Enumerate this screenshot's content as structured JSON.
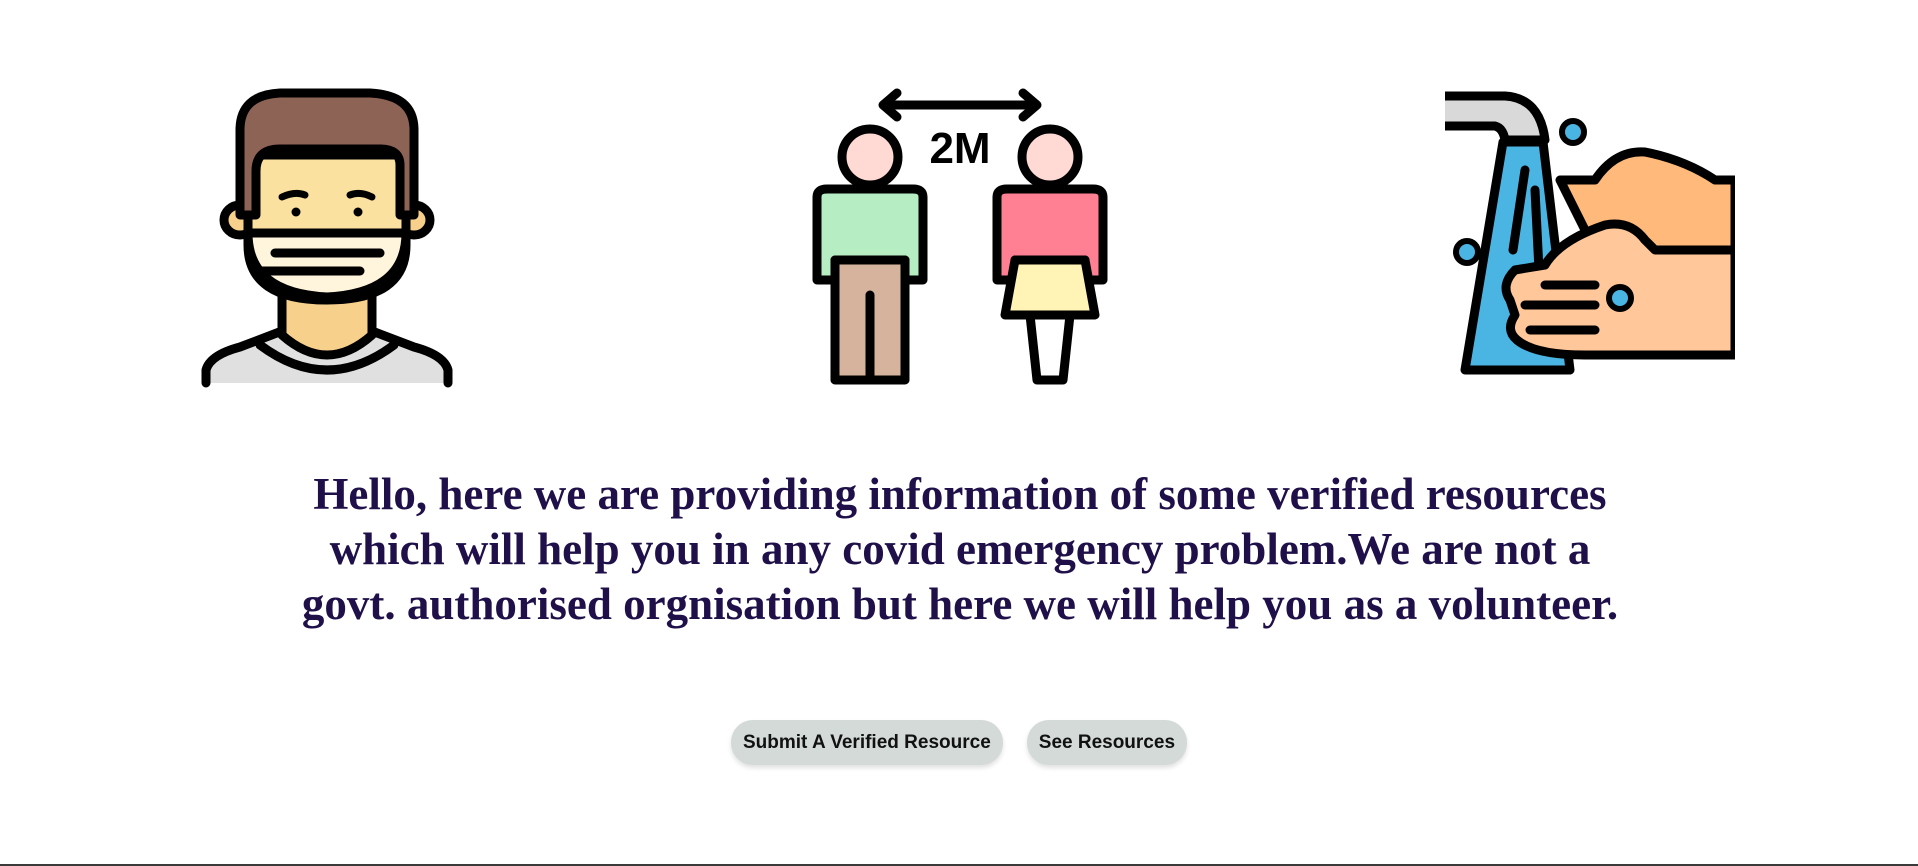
{
  "icons": [
    {
      "name": "face-mask-icon"
    },
    {
      "name": "social-distancing-icon",
      "label": "2M"
    },
    {
      "name": "hand-washing-icon"
    }
  ],
  "intro": {
    "text": "Hello, here we are providing information of some verified resources which will help you in any covid emergency problem.We are not a govt. authorised orgnisation but here we will help you as a volunteer."
  },
  "actions": {
    "submit_label": "Submit A Verified Resource",
    "see_label": "See Resources"
  },
  "colors": {
    "heading": "#1f1049",
    "button_bg": "#d3dad8",
    "outline": "#000000"
  }
}
